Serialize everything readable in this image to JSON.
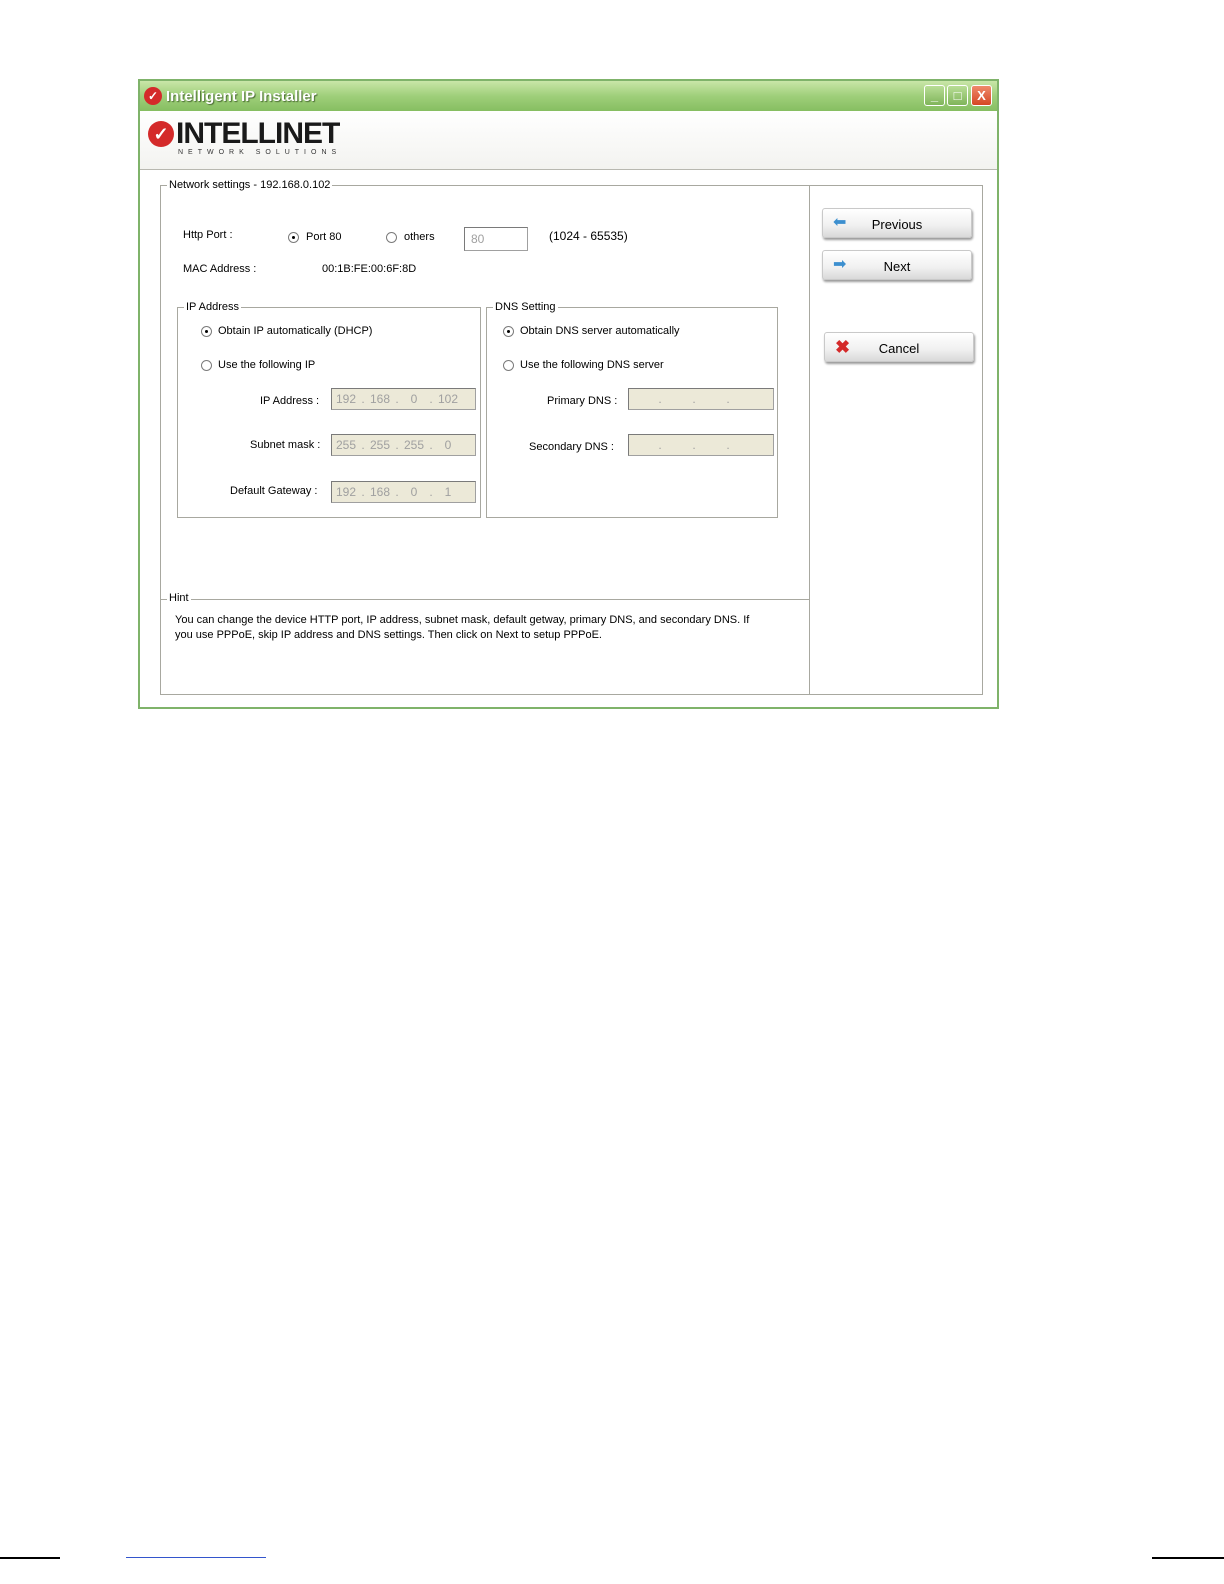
{
  "window": {
    "title": "Intelligent IP Installer",
    "controls": {
      "minimize": "_",
      "maximize": "□",
      "close": "X"
    }
  },
  "banner": {
    "brand_name": "INTELLINET",
    "brand_sub": "NETWORK SOLUTIONS"
  },
  "network": {
    "legend": "Network settings - 192.168.0.102",
    "http_port_label": "Http Port :",
    "port80_label": "Port 80",
    "others_label": "others",
    "others_value": "80",
    "port_range": "(1024 - 65535)",
    "mac_label": "MAC Address :",
    "mac_value": "00:1B:FE:00:6F:8D"
  },
  "ip_group": {
    "legend": "IP Address",
    "auto_label": "Obtain IP automatically (DHCP)",
    "manual_label": "Use the following IP",
    "ip_label": "IP Address :",
    "ip_value": [
      "192",
      "168",
      "0",
      "102"
    ],
    "subnet_label": "Subnet mask :",
    "subnet_value": [
      "255",
      "255",
      "255",
      "0"
    ],
    "gateway_label": "Default Gateway :",
    "gateway_value": [
      "192",
      "168",
      "0",
      "1"
    ]
  },
  "dns_group": {
    "legend": "DNS Setting",
    "auto_label": "Obtain DNS server automatically",
    "manual_label": "Use the following DNS server",
    "primary_label": "Primary DNS :",
    "secondary_label": "Secondary DNS :"
  },
  "hint": {
    "legend": "Hint",
    "line1": "You can change the device HTTP port, IP address, subnet mask, default getway, primary DNS, and secondary DNS. If",
    "line2": "you use PPPoE, skip IP address and DNS settings. Then click on Next to setup PPPoE."
  },
  "buttons": {
    "previous": "Previous",
    "next": "Next",
    "cancel": "Cancel"
  },
  "colors": {
    "title_bar": "#9fcf7a",
    "brand_red": "#d42a2a",
    "disabled_field": "#ece9d8"
  }
}
